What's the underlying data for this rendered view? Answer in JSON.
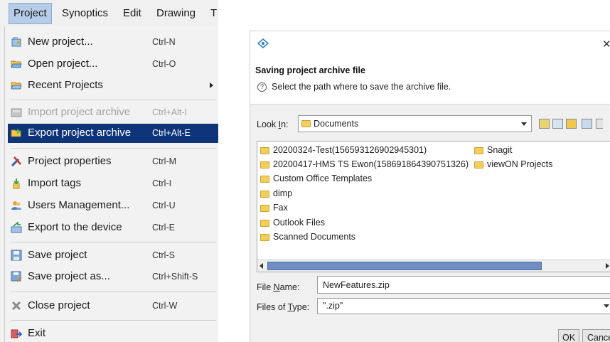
{
  "menubar": {
    "items": [
      "Project",
      "Synoptics",
      "Edit",
      "Drawing",
      "T"
    ]
  },
  "project_menu": {
    "items": [
      {
        "label": "New project...",
        "shortcut": "Ctrl-N",
        "icon": "new-project-icon"
      },
      {
        "label": "Open project...",
        "shortcut": "Ctrl-O",
        "icon": "open-folder-icon"
      },
      {
        "label": "Recent Projects",
        "shortcut": "",
        "icon": "recent-folder-icon"
      },
      {
        "label": "Import project archive",
        "shortcut": "Ctrl+Alt-I",
        "icon": "import-archive-icon"
      },
      {
        "label": "Export project archive",
        "shortcut": "Ctrl+Alt-E",
        "icon": "export-archive-icon"
      },
      {
        "label": "Project properties",
        "shortcut": "Ctrl-M",
        "icon": "tools-icon"
      },
      {
        "label": "Import tags",
        "shortcut": "Ctrl-I",
        "icon": "import-tags-icon"
      },
      {
        "label": "Users Management...",
        "shortcut": "Ctrl-U",
        "icon": "users-icon"
      },
      {
        "label": "Export to the device",
        "shortcut": "Ctrl-E",
        "icon": "export-device-icon"
      },
      {
        "label": "Save project",
        "shortcut": "Ctrl-S",
        "icon": "save-icon"
      },
      {
        "label": "Save project as...",
        "shortcut": "Ctrl+Shift-S",
        "icon": "save-as-icon"
      },
      {
        "label": "Close project",
        "shortcut": "Ctrl-W",
        "icon": "close-project-icon"
      },
      {
        "label": "Exit",
        "shortcut": "",
        "icon": "exit-icon"
      }
    ]
  },
  "dialog": {
    "close_glyph": "✕",
    "title": "Saving project archive file",
    "help_glyph": "?",
    "description": "Select the path where to save the archive file.",
    "look_in_label_pre": "Look ",
    "look_in_label_key": "I",
    "look_in_label_post": "n:",
    "look_in_value": "Documents",
    "files": [
      "20200324-Test(156593126902945301)",
      "20200417-HMS TS Ewon(158691864390751326)",
      "Custom Office Templates",
      "dimp",
      "Fax",
      "Outlook Files",
      "Scanned Documents",
      "Snagit",
      "viewON Projects"
    ],
    "file_name_label_pre": "File ",
    "file_name_label_key": "N",
    "file_name_label_post": "ame:",
    "file_name_value": "NewFeatures.zip",
    "files_of_type_label_pre": "Files of ",
    "files_of_type_label_key": "T",
    "files_of_type_label_post": "ype:",
    "files_of_type_value": "\".zip\"",
    "ok_label": "OK",
    "cancel_label": "Cancel"
  },
  "colors": {
    "menu_highlight": "#0e347a",
    "menubar_active": "#b7cce8",
    "scroll_thumb": "#6f8fc4",
    "folder": "#f3cf5a"
  }
}
